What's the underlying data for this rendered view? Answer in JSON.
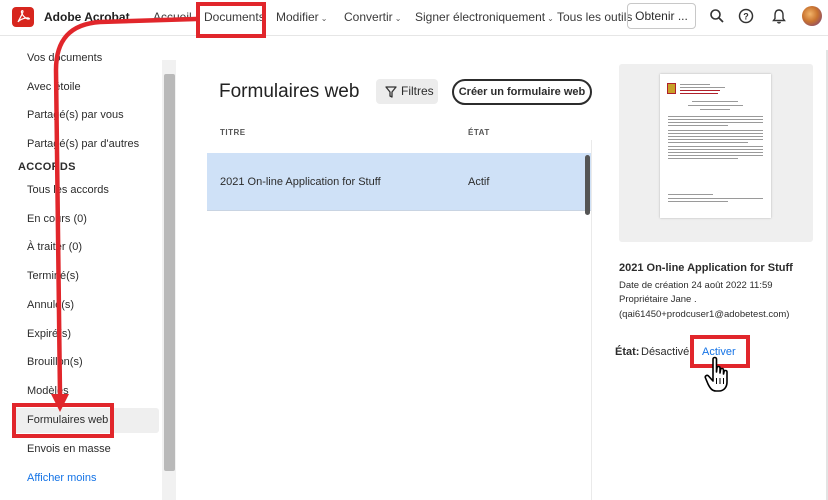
{
  "app": {
    "brand": "Adobe Acrobat",
    "brand_color": "#d7261e"
  },
  "topnav": {
    "items": [
      {
        "label": "Accueil",
        "has_menu": false
      },
      {
        "label": "Documents",
        "has_menu": false,
        "highlighted": true
      },
      {
        "label": "Modifier",
        "has_menu": true
      },
      {
        "label": "Convertir",
        "has_menu": true
      },
      {
        "label": "Signer électroniquement",
        "has_menu": true
      },
      {
        "label": "Tous les outils",
        "has_menu": false
      }
    ],
    "obtenir_label": "Obtenir ...",
    "icons": [
      "search-icon",
      "help-icon",
      "bell-icon",
      "avatar"
    ]
  },
  "sidebar": {
    "items_top": [
      {
        "label": "Vos documents"
      },
      {
        "label": "Avec étoile"
      },
      {
        "label": "Partagé(s) par vous"
      },
      {
        "label": "Partagé(s) par d'autres"
      }
    ],
    "section_label": "ACCORDS",
    "items_accords": [
      {
        "label": "Tous les accords"
      },
      {
        "label": "En cours (0)"
      },
      {
        "label": "À traiter (0)"
      },
      {
        "label": "Terminé(s)"
      },
      {
        "label": "Annulé(s)"
      },
      {
        "label": "Expiré(s)"
      },
      {
        "label": "Brouillon(s)"
      },
      {
        "label": "Modèles"
      },
      {
        "label": "Formulaires web",
        "active": true,
        "highlighted": true
      },
      {
        "label": "Envois en masse"
      }
    ],
    "show_less": "Afficher moins"
  },
  "main": {
    "title": "Formulaires web",
    "filter_label": "Filtres",
    "create_label": "Créer un formulaire web",
    "columns": {
      "title": "TITRE",
      "state": "ÉTAT"
    },
    "rows": [
      {
        "title": "2021 On-line Application for Stuff",
        "state": "Actif",
        "selected": true
      }
    ]
  },
  "detail": {
    "title": "2021 On-line Application for Stuff",
    "created": "Date de création 24 août 2022 11:59",
    "owner": "Propriétaire Jane .",
    "email": "(qai61450+prodcuser1@adobetest.com)",
    "state_label": "État:",
    "state_value": "Désactivé",
    "activate_label": "Activer"
  },
  "annotation": {
    "color": "#e1262b"
  }
}
